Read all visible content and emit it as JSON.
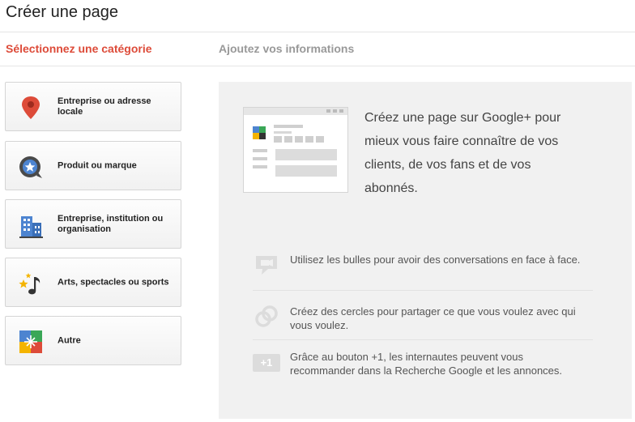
{
  "page": {
    "title": "Créer une page"
  },
  "steps": {
    "active": "Sélectionnez une catégorie",
    "next": "Ajoutez vos informations"
  },
  "categories": [
    {
      "label": "Entreprise ou adresse locale",
      "icon": "map-pin-icon"
    },
    {
      "label": "Produit ou marque",
      "icon": "product-tag-icon"
    },
    {
      "label": "Entreprise, institution ou organisation",
      "icon": "building-icon"
    },
    {
      "label": "Arts, spectacles ou sports",
      "icon": "music-stars-icon"
    },
    {
      "label": "Autre",
      "icon": "google-squares-icon"
    }
  ],
  "info": {
    "headline": "Créez une page sur Google+ pour mieux vous faire connaître de vos clients, de vos fans et de vos abonnés.",
    "features": [
      {
        "icon": "hangout-bubble-icon",
        "text": "Utilisez les bulles pour avoir des conversations en face à face."
      },
      {
        "icon": "circles-icon",
        "text": "Créez des cercles pour partager ce que vous voulez avec qui vous voulez."
      },
      {
        "icon": "plus-one-icon",
        "badge": "+1",
        "text": "Grâce au bouton +1, les internautes peuvent vous recommander dans la Recherche Google et les annonces."
      }
    ]
  },
  "colors": {
    "accent": "#dd4b39",
    "muted": "#999999",
    "panel": "#f1f1f1"
  }
}
